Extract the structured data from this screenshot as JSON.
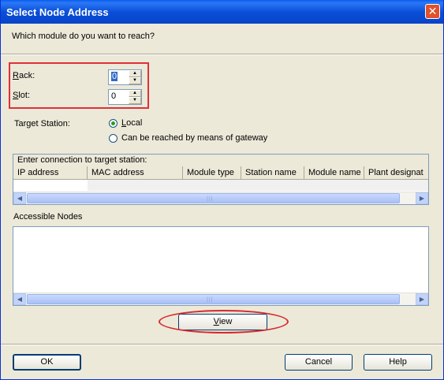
{
  "window": {
    "title": "Select Node Address",
    "close_glyph": "✕"
  },
  "question": "Which module do you want to reach?",
  "rack": {
    "label_first": "R",
    "label_rest": "ack:",
    "value": "0"
  },
  "slot": {
    "label_first": "S",
    "label_rest": "lot:",
    "value": "0"
  },
  "target_station": {
    "label": "Target Station:",
    "options": [
      {
        "first": "L",
        "rest": "ocal",
        "selected": true
      },
      {
        "pre": "Can be reached by means of ",
        "first": "g",
        "rest": "ateway",
        "selected": false
      }
    ]
  },
  "connection_table": {
    "caption": "Enter connection to target station:",
    "columns": [
      "IP address",
      "MAC address",
      "Module type",
      "Station name",
      "Module name",
      "Plant designat"
    ]
  },
  "accessible_nodes": {
    "label": "Accessible Nodes"
  },
  "scroll": {
    "left": "◀",
    "right": "▶",
    "grip": "|||"
  },
  "buttons": {
    "view": {
      "first": "V",
      "rest": "iew"
    },
    "ok": "OK",
    "cancel": "Cancel",
    "help": "Help"
  },
  "colors": {
    "title_bar": "#0a4fd8",
    "highlight": "#e0303a",
    "dialog_bg": "#ece9d8"
  }
}
